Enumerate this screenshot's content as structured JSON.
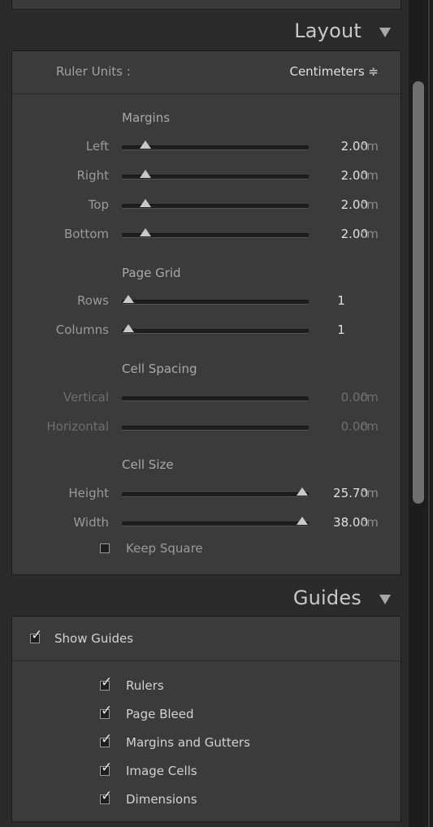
{
  "layout": {
    "title": "Layout",
    "ruler_units": {
      "label": "Ruler Units :",
      "value": "Centimeters ≑"
    },
    "margins": {
      "title": "Margins",
      "rows": [
        {
          "label": "Left",
          "value": "2.00",
          "unit": "cm",
          "level": 0.1
        },
        {
          "label": "Right",
          "value": "2.00",
          "unit": "cm",
          "level": 0.1
        },
        {
          "label": "Top",
          "value": "2.00",
          "unit": "cm",
          "level": 0.1
        },
        {
          "label": "Bottom",
          "value": "2.00",
          "unit": "cm",
          "level": 0.1
        }
      ]
    },
    "page_grid": {
      "title": "Page Grid",
      "rows": [
        {
          "label": "Rows",
          "value": "1",
          "level": 0.0
        },
        {
          "label": "Columns",
          "value": "1",
          "level": 0.0
        }
      ]
    },
    "cell_spacing": {
      "title": "Cell Spacing",
      "rows": [
        {
          "label": "Vertical",
          "value": "0.00",
          "unit": "cm"
        },
        {
          "label": "Horizontal",
          "value": "0.00",
          "unit": "cm"
        }
      ]
    },
    "cell_size": {
      "title": "Cell Size",
      "rows": [
        {
          "label": "Height",
          "value": "25.70",
          "unit": "cm",
          "level": 1.0
        },
        {
          "label": "Width",
          "value": "38.00",
          "unit": "cm",
          "level": 1.0
        }
      ],
      "keep_square": {
        "label": "Keep Square",
        "checked": false
      }
    }
  },
  "guides": {
    "title": "Guides",
    "show_guides": {
      "label": "Show Guides",
      "checked": true
    },
    "items": [
      {
        "label": "Rulers",
        "checked": true
      },
      {
        "label": "Page Bleed",
        "checked": true
      },
      {
        "label": "Margins and Gutters",
        "checked": true
      },
      {
        "label": "Image Cells",
        "checked": true
      },
      {
        "label": "Dimensions",
        "checked": true
      }
    ]
  }
}
